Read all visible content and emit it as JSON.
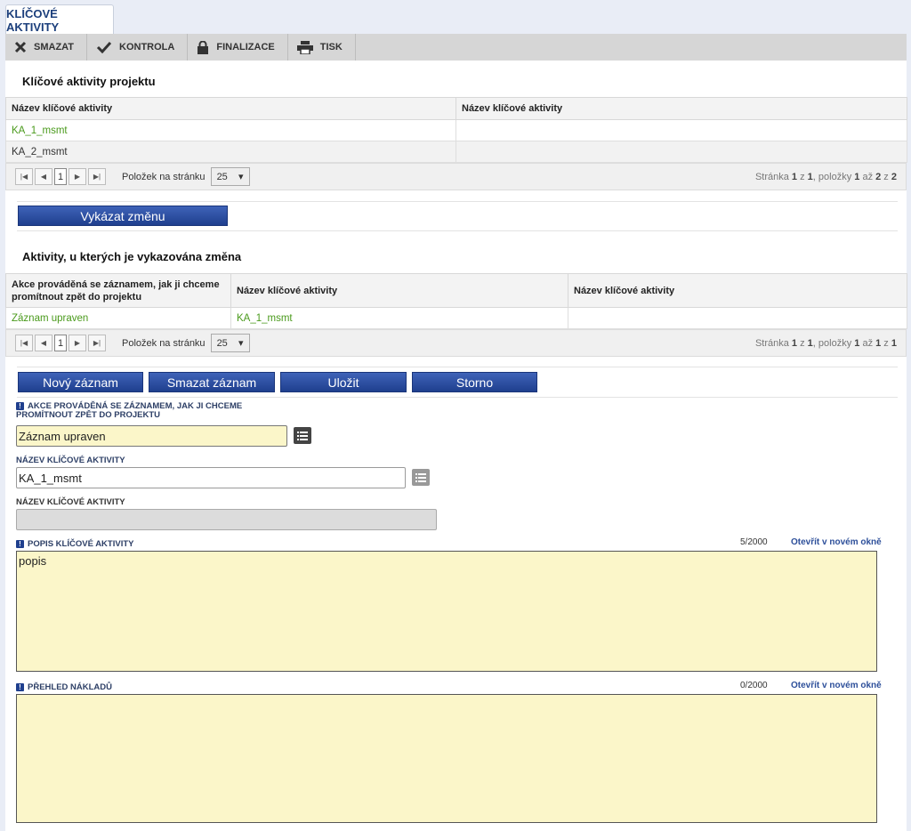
{
  "tab": {
    "label": "KLÍČOVÉ AKTIVITY"
  },
  "toolbar": {
    "delete": "SMAZAT",
    "check": "KONTROLA",
    "finalize": "FINALIZACE",
    "print": "TISK"
  },
  "section1": {
    "title": "Klíčové aktivity projektu",
    "columns": [
      "Název klíčové aktivity",
      "Název klíčové aktivity"
    ],
    "rows": [
      [
        "KA_1_msmt",
        ""
      ],
      [
        "KA_2_msmt",
        ""
      ]
    ],
    "pager": {
      "page": "1",
      "per_page_label": "Položek na stránku",
      "per_page": "25",
      "info_prefix": "Stránka ",
      "page_cur": "1",
      "info_z1": " z ",
      "page_total": "1",
      "info_items": ", položky ",
      "from": "1",
      "info_to": " až ",
      "to": "2",
      "info_z2": " z ",
      "total": "2"
    }
  },
  "report_change_button": "Vykázat změnu",
  "section2": {
    "title": "Aktivity, u kterých je vykazována změna",
    "columns": [
      "Akce prováděná se záznamem, jak ji chceme promítnout zpět do projektu",
      "Název klíčové aktivity",
      "Název klíčové aktivity"
    ],
    "rows": [
      [
        "Záznam upraven",
        "KA_1_msmt",
        ""
      ]
    ],
    "pager": {
      "page": "1",
      "per_page_label": "Položek na stránku",
      "per_page": "25",
      "info_prefix": "Stránka ",
      "page_cur": "1",
      "info_z1": " z ",
      "page_total": "1",
      "info_items": ", položky ",
      "from": "1",
      "info_to": " až ",
      "to": "1",
      "info_z2": " z ",
      "total": "1"
    }
  },
  "actions": {
    "new": "Nový záznam",
    "delete": "Smazat záznam",
    "save": "Uložit",
    "cancel": "Storno"
  },
  "form": {
    "action_label": "AKCE PROVÁDĚNÁ SE ZÁZNAMEM, JAK JI CHCEME PROMÍTNOUT ZPĚT DO PROJEKTU",
    "action_value": "Záznam upraven",
    "name_label": "NÁZEV KLÍČOVÉ AKTIVITY",
    "name_value": "KA_1_msmt",
    "name2_label": "NÁZEV KLÍČOVÉ AKTIVITY",
    "name2_value": "",
    "desc_label": "POPIS KLÍČOVÉ AKTIVITY",
    "desc_counter": "5/2000",
    "desc_open": "Otevřít v novém okně",
    "desc_value": "popis",
    "costs_label": "PŘEHLED NÁKLADŮ",
    "costs_counter": "0/2000",
    "costs_open": "Otevřít v novém okně",
    "costs_value": ""
  },
  "colors": {
    "accent": "#1f3f8e",
    "link_green": "#4a9a1c",
    "field_yellow": "#fbf6c9"
  }
}
